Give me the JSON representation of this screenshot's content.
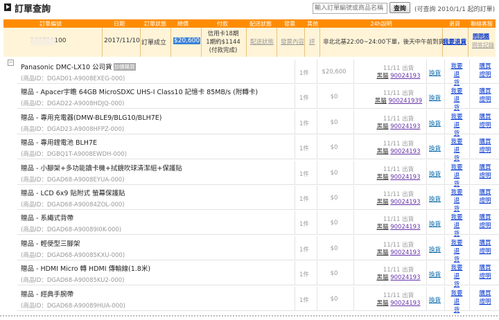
{
  "page": {
    "title": "訂單查詢",
    "search_placeholder": "輸入訂單編號或商品名稱",
    "search_button": "查詢",
    "query_note": "(可查詢 2010/1/1 起的訂單)"
  },
  "order_table": {
    "headers": {
      "order_no": "訂單編號",
      "date": "日期",
      "status": "訂單狀態",
      "total": "總價",
      "payment": "付款",
      "delivery_status": "配送狀態",
      "invoice": "發票",
      "other": "其他",
      "delivery_note": "24h說明",
      "return": "退貨",
      "service": "聯絡客服"
    },
    "order": {
      "order_no": "201711100",
      "date": "2017/11/10",
      "status": "訂單成立",
      "total": "$20,600",
      "payment_line1": "信用卡18期",
      "payment_line2": "1期約$1144",
      "payment_line3": "(付款完成)",
      "delivery_status": "配送狀態",
      "invoice": "發票內容",
      "other": "評",
      "delivery_note": "非北北基22:00~24:00下單，後天中午前到貨",
      "return": "我要退貨",
      "service_line1": "問問題",
      "service_line2": "問答記錄"
    }
  },
  "items": [
    {
      "name": "Panasonic DMC-LX10 公司貨",
      "pid": "(商品ID：DGAD01-A9008EXEG-000)",
      "badge": "加價購買",
      "qty": "1件",
      "price": "$20,600",
      "ship_date": "11/11 出貨",
      "carrier": "黑貓",
      "tracking": "90024193",
      "exchange": "換貨",
      "return1": "我要退",
      "return2": "貨",
      "buy1": "購買",
      "buy2": "證明"
    },
    {
      "name": "贈品 - Apacer宇瞻 64GB MicroSDXC UHS-I Class10 記憶卡 85MB/s (附轉卡)",
      "pid": "(商品ID：DGAD22-A9008HDJQ-000)",
      "qty": "1件",
      "price": "$0",
      "ship_date": "11/11 出貨",
      "carrier": "黑貓",
      "tracking": "900241939",
      "exchange": "換貨",
      "return1": "我要退",
      "return2": "貨",
      "buy1": "購買",
      "buy2": "證明"
    },
    {
      "name": "贈品 - 專用充電器(DMW-BLE9/BLG10/BLH7E)",
      "pid": "(商品ID：DGAD23-A9008HFPZ-000)",
      "qty": "1件",
      "price": "$0",
      "ship_date": "11/11 出貨",
      "carrier": "黑貓",
      "tracking": "90024193",
      "exchange": "換貨",
      "return1": "我要退",
      "return2": "貨",
      "buy1": "購買",
      "buy2": "證明"
    },
    {
      "name": "贈品 - 專用鋰電池 BLH7E",
      "pid": "(商品ID：DGBQ1T-A9008EWDH-000)",
      "qty": "1件",
      "price": "$0",
      "ship_date": "11/11 出貨",
      "carrier": "黑貓",
      "tracking": "90024193",
      "exchange": "換貨",
      "return1": "我要退",
      "return2": "貨",
      "buy1": "購買",
      "buy2": "證明"
    },
    {
      "name": "贈品 - 小腳架+多功能讀卡機+拭鏡吹球清潔組+保護貼",
      "pid": "(商品ID：DGAD68-A9008EYUA-000)",
      "qty": "1件",
      "price": "$0",
      "ship_date": "11/11 出貨",
      "carrier": "黑貓",
      "tracking": "90024193",
      "exchange": "換貨",
      "return1": "我要退",
      "return2": "貨",
      "buy1": "購買",
      "buy2": "證明"
    },
    {
      "name": "贈品 - LCD 6x9 貼附式 螢幕保護貼",
      "pid": "(商品ID：DGAD68-A90084ZOL-000)",
      "qty": "1件",
      "price": "$0",
      "ship_date": "11/11 出貨",
      "carrier": "黑貓",
      "tracking": "90024193",
      "exchange": "換貨",
      "return1": "我要退",
      "return2": "貨",
      "buy1": "購買",
      "buy2": "證明"
    },
    {
      "name": "贈品 - 系繩式背帶",
      "pid": "(商品ID：DGAD68-A90089I0K-000)",
      "qty": "1件",
      "price": "$0",
      "ship_date": "11/11 出貨",
      "carrier": "黑貓",
      "tracking": "90024193",
      "exchange": "換貨",
      "return1": "我要退",
      "return2": "貨",
      "buy1": "購買",
      "buy2": "證明"
    },
    {
      "name": "贈品 - 輕便型三腳架",
      "pid": "(商品ID：DGAD68-A90085KXU-000)",
      "qty": "1件",
      "price": "$0",
      "ship_date": "11/11 出貨",
      "carrier": "黑貓",
      "tracking": "90024193",
      "exchange": "換貨",
      "return1": "我要退",
      "return2": "貨",
      "buy1": "購買",
      "buy2": "證明"
    },
    {
      "name": "贈品 - HDMI Micro 轉 HDMI 傳輸線(1.8米)",
      "pid": "(商品ID：DGAD68-A90085KU2-000)",
      "qty": "1件",
      "price": "$0",
      "ship_date": "11/11 出貨",
      "carrier": "黑貓",
      "tracking": "90024193",
      "exchange": "換貨",
      "return1": "我要退",
      "return2": "貨",
      "buy1": "購買",
      "buy2": "證明"
    },
    {
      "name": "贈品 - 經典手腕帶",
      "pid": "(商品ID：DGAD68-A90089HUA-000)",
      "qty": "1件",
      "price": "$0",
      "ship_date": "11/11 出貨",
      "carrier": "黑貓",
      "tracking": "90024193",
      "exchange": "換貨",
      "return1": "我要退",
      "return2": "貨",
      "buy1": "購買",
      "buy2": "證明"
    }
  ]
}
